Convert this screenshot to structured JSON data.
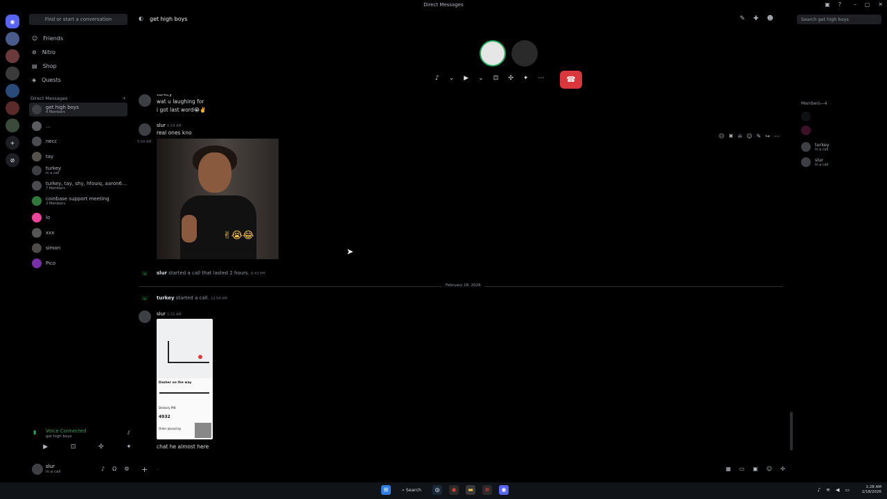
{
  "window": {
    "title": "Direct Messages"
  },
  "sidebar": {
    "find_placeholder": "Find or start a conversation",
    "nav": [
      {
        "label": "Friends",
        "icon": "friends-icon"
      },
      {
        "label": "Nitro",
        "icon": "nitro-icon"
      },
      {
        "label": "Shop",
        "icon": "shop-icon"
      },
      {
        "label": "Quests",
        "icon": "quests-icon"
      }
    ],
    "dm_header": "Direct Messages",
    "dms": [
      {
        "name": "get high boys",
        "sub": "4 Members"
      },
      {
        "name": "…",
        "sub": ""
      },
      {
        "name": "necc",
        "sub": ""
      },
      {
        "name": "tay",
        "sub": ""
      },
      {
        "name": "turkey",
        "sub": "In a call"
      },
      {
        "name": "turkey, tay, shy, hfouiq, aaron6…",
        "sub": "7 Members"
      },
      {
        "name": "coinbase support meeting",
        "sub": "3 Members"
      },
      {
        "name": "lo",
        "sub": ""
      },
      {
        "name": "xxx",
        "sub": ""
      },
      {
        "name": "simon",
        "sub": ""
      },
      {
        "name": "Pico",
        "sub": ""
      }
    ],
    "voice": {
      "status": "Voice Connected",
      "channel": "get high boys"
    },
    "user": {
      "name": "slur",
      "status": "In a call"
    }
  },
  "header": {
    "channel": "get high boys",
    "search_placeholder": "Search get high boys"
  },
  "chat": {
    "msg1_author": "turkey",
    "msg1_line1": "wat u laughing for",
    "msg1_line2": "i got last word😭✌️",
    "msg2_author": "slur",
    "msg2_time": "5:54 AM",
    "msg2_side_time": "5:54 AM",
    "msg2_text": "real ones kno",
    "gif_emoji": "✌😭😂",
    "sys1_author": "slur",
    "sys1_text": " started a call that lasted 2 hours.",
    "sys1_time": "6:43 PM",
    "date_divider": "February 18, 2026",
    "sys2_author": "turkey",
    "sys2_text": " started a call.",
    "sys2_time": "12:54 AM",
    "msg3_author": "slur",
    "msg3_time": "1:21 AM",
    "msg3_text": "chat he almost here",
    "shot_title": "Dasher on the way",
    "shot_code": "4932",
    "shot_delivery": "Delivery PIN",
    "shot_footer": "Order placed by"
  },
  "members": {
    "header": "Members—4",
    "list": [
      {
        "name": "turkey",
        "status": "In a call"
      },
      {
        "name": "slur",
        "status": "In a call"
      }
    ]
  },
  "taskbar": {
    "search": "Search",
    "time": "1:28 AM",
    "date": "2/18/2026"
  }
}
